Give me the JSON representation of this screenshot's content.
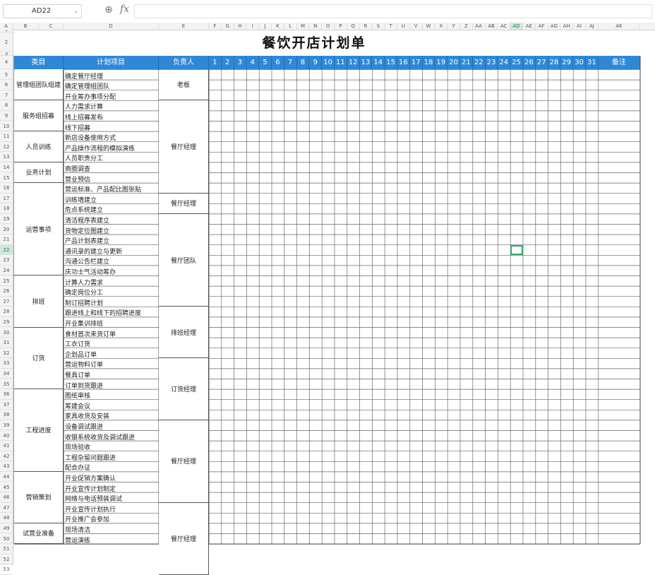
{
  "formula_bar": {
    "name_box": "AD22",
    "fx": "fx"
  },
  "sheet": {
    "title": "餐饮开店计划单",
    "headers": {
      "category": "类目",
      "item": "计划项目",
      "owner": "负责人",
      "note": "备注"
    },
    "days": [
      "1",
      "2",
      "3",
      "4",
      "5",
      "6",
      "7",
      "8",
      "9",
      "10",
      "11",
      "12",
      "13",
      "14",
      "15",
      "16",
      "17",
      "18",
      "19",
      "20",
      "21",
      "22",
      "23",
      "24",
      "25",
      "26",
      "27",
      "28",
      "29",
      "30",
      "31"
    ],
    "columns": [
      "A",
      "B",
      "C",
      "D",
      "E",
      "F",
      "G",
      "H",
      "I",
      "J",
      "K",
      "L",
      "M",
      "N",
      "O",
      "P",
      "Q",
      "R",
      "S",
      "T",
      "U",
      "V",
      "W",
      "X",
      "Y",
      "Z",
      "AA",
      "AB",
      "AC",
      "AD",
      "AE",
      "AF",
      "AG",
      "AH",
      "AI",
      "AJ",
      "AK"
    ],
    "selected_column": "AD",
    "rows": [
      "1",
      "2",
      "3",
      "4",
      "5",
      "6",
      "7",
      "8",
      "9",
      "10",
      "11",
      "12",
      "13",
      "14",
      "15",
      "16",
      "17",
      "18",
      "19",
      "20",
      "21",
      "22",
      "23",
      "24",
      "25",
      "26",
      "27",
      "28",
      "29",
      "30",
      "31",
      "32",
      "33",
      "34",
      "35",
      "36",
      "37",
      "38",
      "39",
      "40",
      "41",
      "42",
      "43",
      "44",
      "45",
      "46",
      "47",
      "48",
      "49",
      "50",
      "51",
      "52",
      "53"
    ],
    "selected_row": "22",
    "groups": [
      {
        "category": "管理组团队组建",
        "items": [
          "确定餐厅经理",
          "确定管理组团队",
          "开业筹办事项分配"
        ]
      },
      {
        "category": "服务组招募",
        "items": [
          "人力需求计算",
          "线上招募发布",
          "线下招募"
        ]
      },
      {
        "category": "人员训练",
        "items": [
          "新店设备使用方式",
          "产品操作流程的模拟演练",
          "人员职责分工"
        ]
      },
      {
        "category": "业务计划",
        "items": [
          "商圈调查",
          "营业预估"
        ]
      },
      {
        "category": "运营事项",
        "items": [
          "营运标准、产品配比图张贴",
          "训练墙建立",
          "危点系统建立",
          "清洁程序表建立",
          "货物定位图建立",
          "产品计划表建立",
          "通讯录的建立与更新",
          "沟通公告栏建立",
          "庆功士气活动筹办"
        ]
      },
      {
        "category": "排班",
        "items": [
          "计算人力需求",
          "确定岗位分工",
          "制订招聘计划",
          "跟进线上和线下的招聘进度",
          "开业集训排班"
        ]
      },
      {
        "category": "订货",
        "items": [
          "食材首次来货订单",
          "工衣订货",
          "企划品订单",
          "营运物料订单",
          "餐具订单",
          "订单到货跟进"
        ]
      },
      {
        "category": "工程进度",
        "items": [
          "图纸审核",
          "筹建会议",
          "家具收货及安装",
          "设备调试跟进",
          "收银系统收货及调试跟进",
          "现场验收",
          "工程杂留问题跟进",
          "配合办证"
        ]
      },
      {
        "category": "营销策划",
        "items": [
          "开业促销方案确认",
          "开业宣传计划制定",
          "网络与电话预装调试",
          "开业宣传计划执行",
          "开业推广会参加"
        ]
      },
      {
        "category": "试营业准备",
        "items": [
          "现场清洁",
          "营运演练"
        ]
      }
    ],
    "owners": [
      {
        "label": "老板"
      },
      {
        "label": "餐厅经理"
      },
      {
        "label": "餐厅经理"
      },
      {
        "label": "餐厅团队"
      },
      {
        "label": "排班经理"
      },
      {
        "label": "订货经理"
      },
      {
        "label": "餐厅经理"
      },
      {
        "label": "餐厅经理"
      }
    ]
  }
}
